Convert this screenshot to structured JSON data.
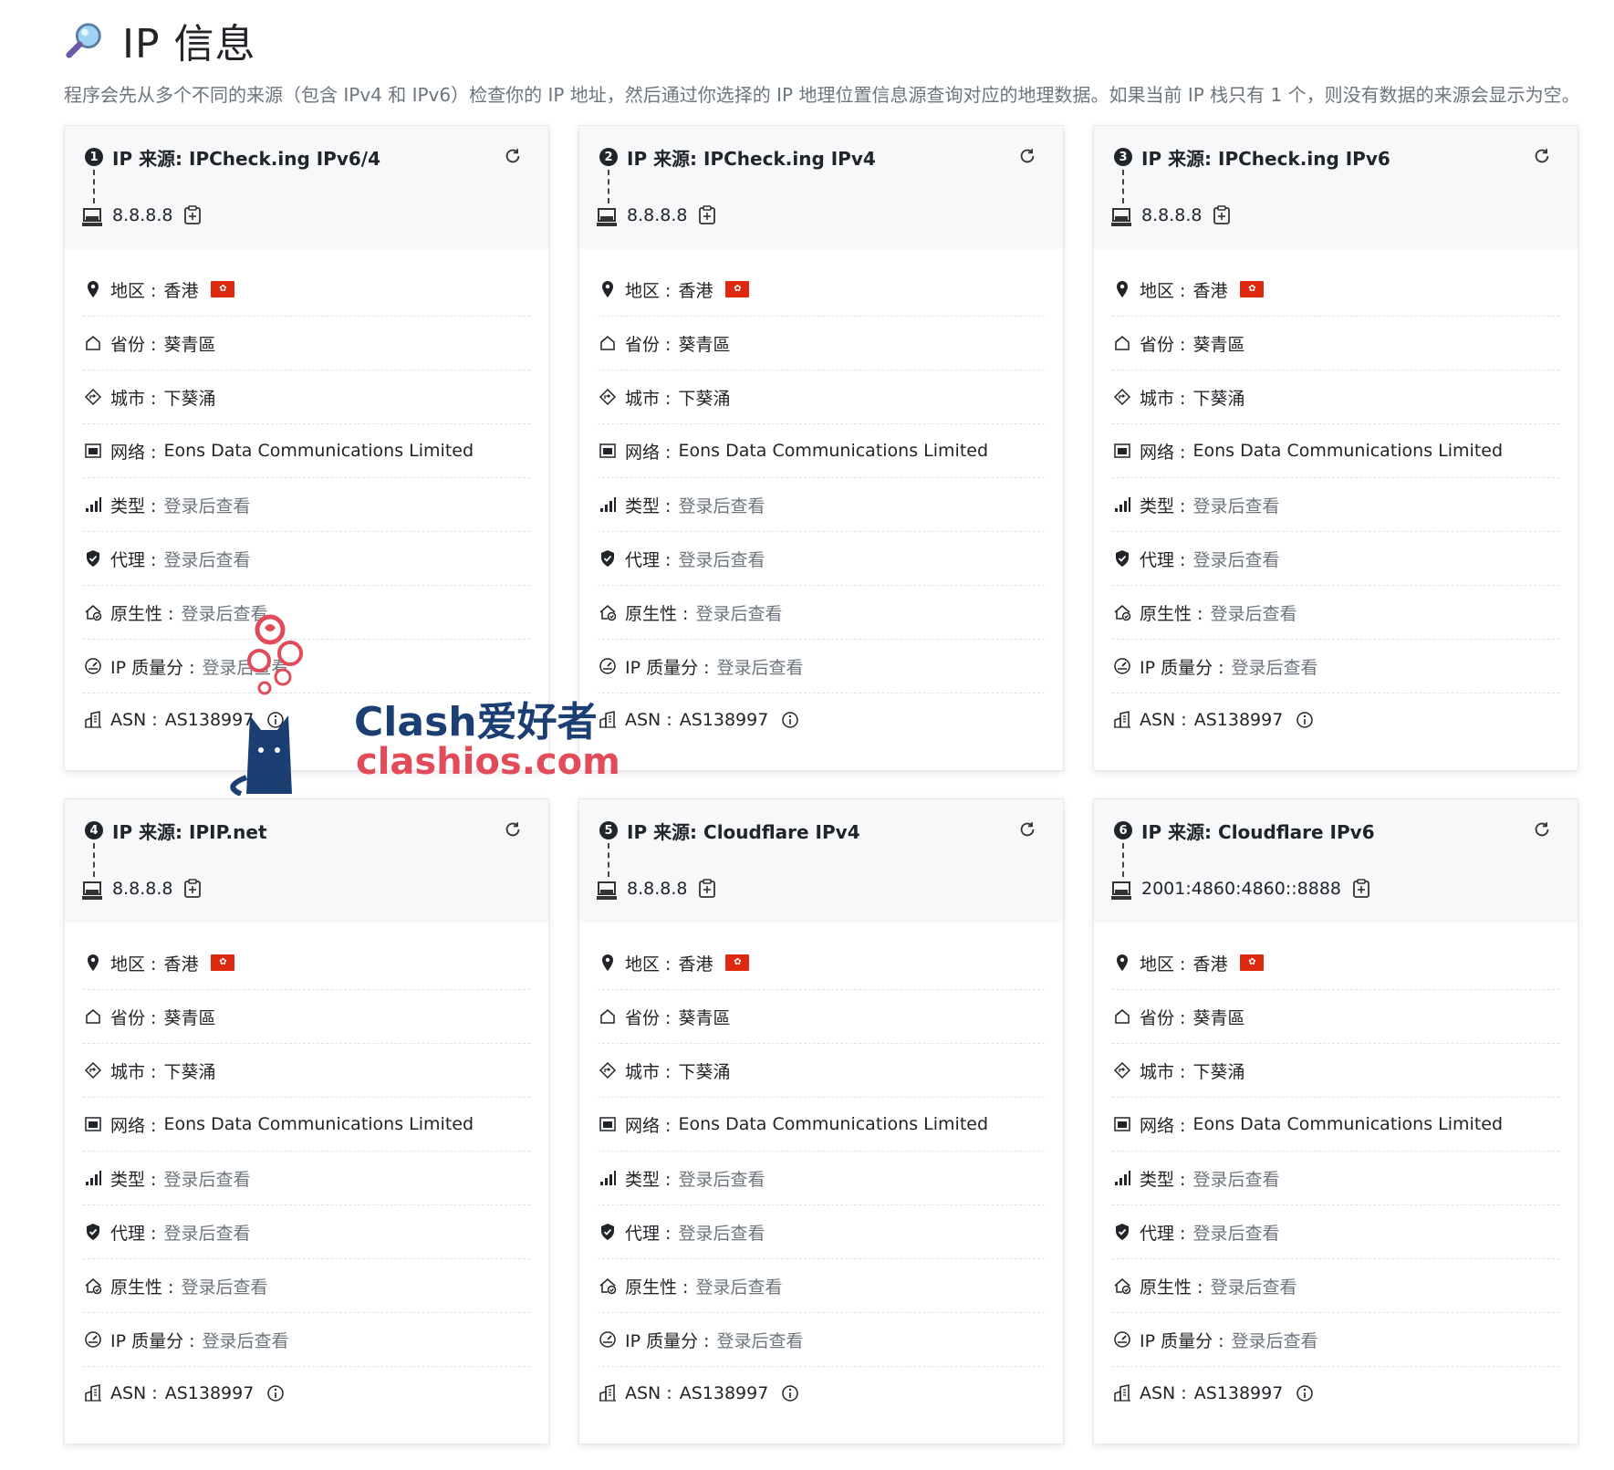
{
  "header": {
    "title": "IP 信息",
    "icon": "magnifier-icon"
  },
  "description": "程序会先从多个不同的来源（包含 IPv4 和 IPv6）检查你的 IP 地址，然后通过你选择的 IP 地理位置信息源查询对应的地理数据。如果当前 IP 栈只有 1 个，则没有数据的来源会显示为空。",
  "labels": {
    "region": "地区 : ",
    "province": "省份 : ",
    "city": "城市 : ",
    "network": "网络 : ",
    "type": "类型 : ",
    "proxy": "代理 : ",
    "native": "原生性 : ",
    "quality": "IP 质量分 : ",
    "asn": "ASN : "
  },
  "cards": [
    {
      "num": "1",
      "title": "IP 来源: IPCheck.ing IPv6/4",
      "ip": "8.8.8.8",
      "region": "香港",
      "province": "葵青區",
      "city": "下葵涌",
      "network": "Eons Data Communications Limited",
      "type": "登录后查看",
      "proxy": "登录后查看",
      "native": "登录后查看",
      "quality": "登录后查看",
      "asn": "AS138997"
    },
    {
      "num": "2",
      "title": "IP 来源: IPCheck.ing IPv4",
      "ip": "8.8.8.8",
      "region": "香港",
      "province": "葵青區",
      "city": "下葵涌",
      "network": "Eons Data Communications Limited",
      "type": "登录后查看",
      "proxy": "登录后查看",
      "native": "登录后查看",
      "quality": "登录后查看",
      "asn": "AS138997"
    },
    {
      "num": "3",
      "title": "IP 来源: IPCheck.ing IPv6",
      "ip": "8.8.8.8",
      "region": "香港",
      "province": "葵青區",
      "city": "下葵涌",
      "network": "Eons Data Communications Limited",
      "type": "登录后查看",
      "proxy": "登录后查看",
      "native": "登录后查看",
      "quality": "登录后查看",
      "asn": "AS138997"
    },
    {
      "num": "4",
      "title": "IP 来源: IPIP.net",
      "ip": "8.8.8.8",
      "region": "香港",
      "province": "葵青區",
      "city": "下葵涌",
      "network": "Eons Data Communications Limited",
      "type": "登录后查看",
      "proxy": "登录后查看",
      "native": "登录后查看",
      "quality": "登录后查看",
      "asn": "AS138997"
    },
    {
      "num": "5",
      "title": "IP 来源: Cloudflare IPv4",
      "ip": "8.8.8.8",
      "region": "香港",
      "province": "葵青區",
      "city": "下葵涌",
      "network": "Eons Data Communications Limited",
      "type": "登录后查看",
      "proxy": "登录后查看",
      "native": "登录后查看",
      "quality": "登录后查看",
      "asn": "AS138997"
    },
    {
      "num": "6",
      "title": "IP 来源: Cloudflare IPv6",
      "ip": "2001:4860:4860::8888",
      "region": "香港",
      "province": "葵青區",
      "city": "下葵涌",
      "network": "Eons Data Communications Limited",
      "type": "登录后查看",
      "proxy": "登录后查看",
      "native": "登录后查看",
      "quality": "登录后查看",
      "asn": "AS138997"
    }
  ],
  "watermark": {
    "line1": "Clash爱好者",
    "line2": "clashios.com"
  },
  "colors": {
    "muted": "#6c757d",
    "flag": "#de2910",
    "watermark_blue": "#1c3f73",
    "watermark_red": "#e14b5a"
  }
}
